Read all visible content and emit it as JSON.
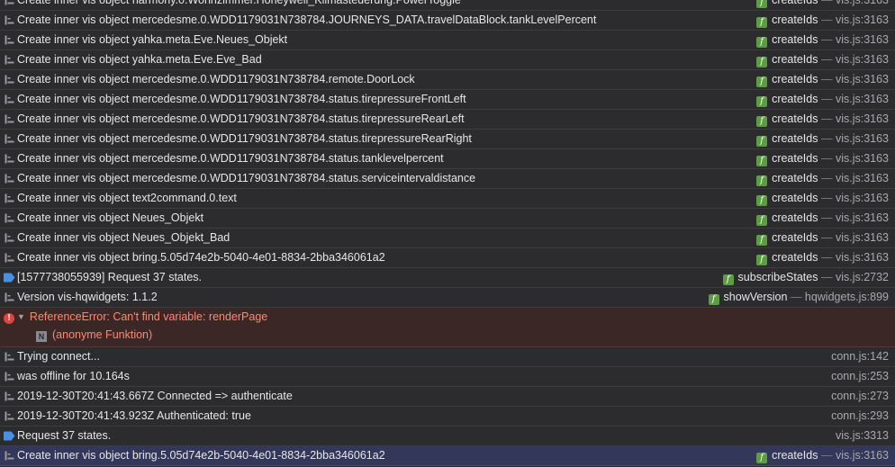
{
  "console": {
    "rows": [
      {
        "type": "log",
        "clipped": true,
        "message": "Create inner vis object harmony.0.Wohnzimmer.Honeywell_Klimasteuerung.PowerToggle",
        "func": "createIds",
        "sep": " — ",
        "source": "vis.js:3163"
      },
      {
        "type": "log",
        "message": "Create inner vis object mercedesme.0.WDD1179031N738784.JOURNEYS_DATA.travelDataBlock.tankLevelPercent",
        "func": "createIds",
        "sep": " — ",
        "source": "vis.js:3163"
      },
      {
        "type": "log",
        "message": "Create inner vis object yahka.meta.Eve.Neues_Objekt",
        "func": "createIds",
        "sep": " — ",
        "source": "vis.js:3163"
      },
      {
        "type": "log",
        "message": "Create inner vis object yahka.meta.Eve.Eve_Bad",
        "func": "createIds",
        "sep": " — ",
        "source": "vis.js:3163"
      },
      {
        "type": "log",
        "message": "Create inner vis object mercedesme.0.WDD1179031N738784.remote.DoorLock",
        "func": "createIds",
        "sep": " — ",
        "source": "vis.js:3163"
      },
      {
        "type": "log",
        "message": "Create inner vis object mercedesme.0.WDD1179031N738784.status.tirepressureFrontLeft",
        "func": "createIds",
        "sep": " — ",
        "source": "vis.js:3163"
      },
      {
        "type": "log",
        "message": "Create inner vis object mercedesme.0.WDD1179031N738784.status.tirepressureRearLeft",
        "func": "createIds",
        "sep": " — ",
        "source": "vis.js:3163"
      },
      {
        "type": "log",
        "message": "Create inner vis object mercedesme.0.WDD1179031N738784.status.tirepressureRearRight",
        "func": "createIds",
        "sep": " — ",
        "source": "vis.js:3163"
      },
      {
        "type": "log",
        "message": "Create inner vis object mercedesme.0.WDD1179031N738784.status.tanklevelpercent",
        "func": "createIds",
        "sep": " — ",
        "source": "vis.js:3163"
      },
      {
        "type": "log",
        "message": "Create inner vis object mercedesme.0.WDD1179031N738784.status.serviceintervaldistance",
        "func": "createIds",
        "sep": " — ",
        "source": "vis.js:3163"
      },
      {
        "type": "log",
        "message": "Create inner vis object text2command.0.text",
        "func": "createIds",
        "sep": " — ",
        "source": "vis.js:3163"
      },
      {
        "type": "log",
        "message": "Create inner vis object Neues_Objekt",
        "func": "createIds",
        "sep": " — ",
        "source": "vis.js:3163"
      },
      {
        "type": "log",
        "message": "Create inner vis object Neues_Objekt_Bad",
        "func": "createIds",
        "sep": " — ",
        "source": "vis.js:3163"
      },
      {
        "type": "log",
        "message": "Create inner vis object bring.5.05d74e2b-5040-4e01-8834-2bba346061a2",
        "func": "createIds",
        "sep": " — ",
        "source": "vis.js:3163"
      },
      {
        "type": "info",
        "message": "[1577738055939] Request 37 states.",
        "func": "subscribeStates",
        "sep": " — ",
        "source": "vis.js:2732"
      },
      {
        "type": "log",
        "message": "Version vis-hqwidgets: 1.1.2",
        "func": "showVersion",
        "sep": " — ",
        "source": "hqwidgets.js:899"
      },
      {
        "type": "error",
        "message": "ReferenceError: Can't find variable: renderPage",
        "frame_badge": "N",
        "frame": "(anonyme Funktion)"
      },
      {
        "type": "log",
        "message": "Trying connect...",
        "source": "conn.js:142"
      },
      {
        "type": "log",
        "message": "was offline for 10.164s",
        "source": "conn.js:253"
      },
      {
        "type": "log",
        "message": "2019-12-30T20:41:43.667Z Connected => authenticate",
        "source": "conn.js:273"
      },
      {
        "type": "log",
        "message": "2019-12-30T20:41:43.923Z Authenticated: true",
        "source": "conn.js:293"
      },
      {
        "type": "info",
        "message": "Request 37 states.",
        "source": "vis.js:3313"
      },
      {
        "type": "log",
        "highlight": true,
        "message": "Create inner vis object bring.5.05d74e2b-5040-4e01-8834-2bba346061a2",
        "func": "createIds",
        "sep": " — ",
        "source": "vis.js:3163"
      }
    ],
    "colors": {
      "background": "#2c2c2e",
      "error_background": "#3b2726",
      "error_text": "#ff8672",
      "highlight_background": "#33385a",
      "function_badge": "#5c9c43",
      "info_icon": "#4a90e2",
      "error_icon": "#e0443e"
    },
    "icons": {
      "log": "log-entry-icon",
      "info": "info-flag-icon",
      "error": "error-circle-icon",
      "function": "function-badge-icon",
      "disclosure": "disclosure-triangle-icon"
    }
  }
}
